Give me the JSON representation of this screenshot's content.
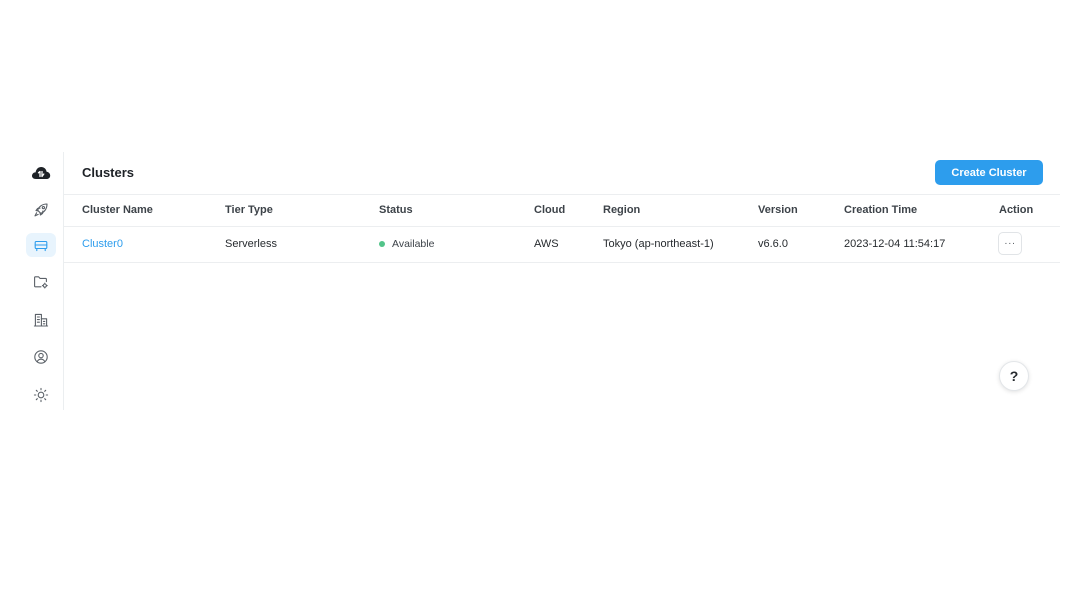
{
  "header": {
    "title": "Clusters",
    "create_button_label": "Create Cluster"
  },
  "sidebar": {
    "items": [
      {
        "name": "logo",
        "icon": "cloud-logo-icon",
        "active": false
      },
      {
        "name": "getting-started",
        "icon": "rocket-icon",
        "active": false
      },
      {
        "name": "clusters",
        "icon": "cluster-icon",
        "active": true
      },
      {
        "name": "projects",
        "icon": "folder-settings-icon",
        "active": false
      },
      {
        "name": "organization",
        "icon": "building-icon",
        "active": false
      },
      {
        "name": "account",
        "icon": "user-circle-icon",
        "active": false
      },
      {
        "name": "theme",
        "icon": "sun-icon",
        "active": false
      }
    ]
  },
  "table": {
    "headers": [
      "Cluster Name",
      "Tier Type",
      "Status",
      "Cloud",
      "Region",
      "Version",
      "Creation Time",
      "Action"
    ],
    "rows": [
      {
        "name": "Cluster0",
        "tier": "Serverless",
        "status": "Available",
        "cloud": "AWS",
        "region": "Tokyo (ap-northeast-1)",
        "version": "v6.6.0",
        "created": "2023-12-04 11:54:17",
        "action": "···"
      }
    ]
  },
  "help_button_label": "?",
  "colors": {
    "accent": "#2d9ded",
    "status_available": "#52c48a",
    "active_nav_bg": "#e8f4fd"
  }
}
